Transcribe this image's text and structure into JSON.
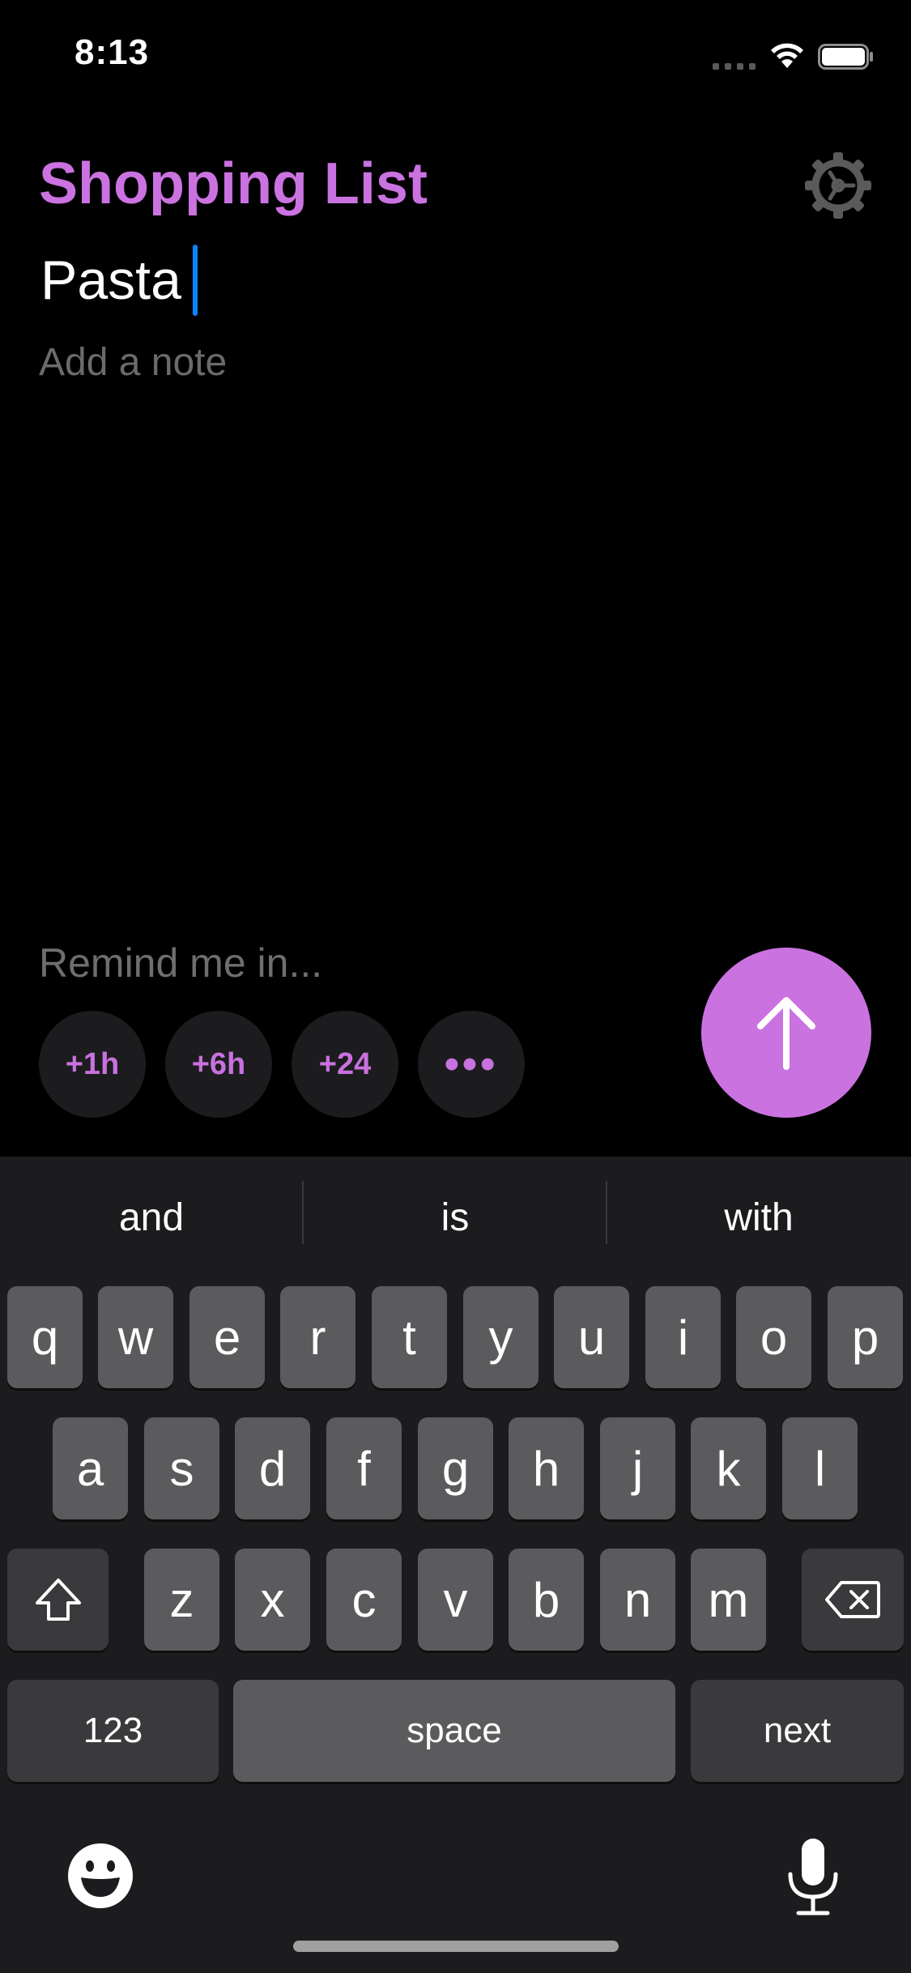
{
  "status_bar": {
    "time": "8:13"
  },
  "header": {
    "title": "Shopping List"
  },
  "item": {
    "title": "Pasta",
    "note_placeholder": "Add a note"
  },
  "reminder": {
    "label": "Remind me in...",
    "chips": [
      "+1h",
      "+6h",
      "+24",
      "•••"
    ]
  },
  "keyboard": {
    "suggestions": [
      "and",
      "is",
      "with"
    ],
    "row1": [
      "q",
      "w",
      "e",
      "r",
      "t",
      "y",
      "u",
      "i",
      "o",
      "p"
    ],
    "row2": [
      "a",
      "s",
      "d",
      "f",
      "g",
      "h",
      "j",
      "k",
      "l"
    ],
    "row3": [
      "z",
      "x",
      "c",
      "v",
      "b",
      "n",
      "m"
    ],
    "numbers_key": "123",
    "space_key": "space",
    "return_key": "next"
  },
  "colors": {
    "accent": "#cb72e1",
    "cursor": "#0a84ff",
    "background": "#000000",
    "keyboard": "#1c1c1e"
  }
}
